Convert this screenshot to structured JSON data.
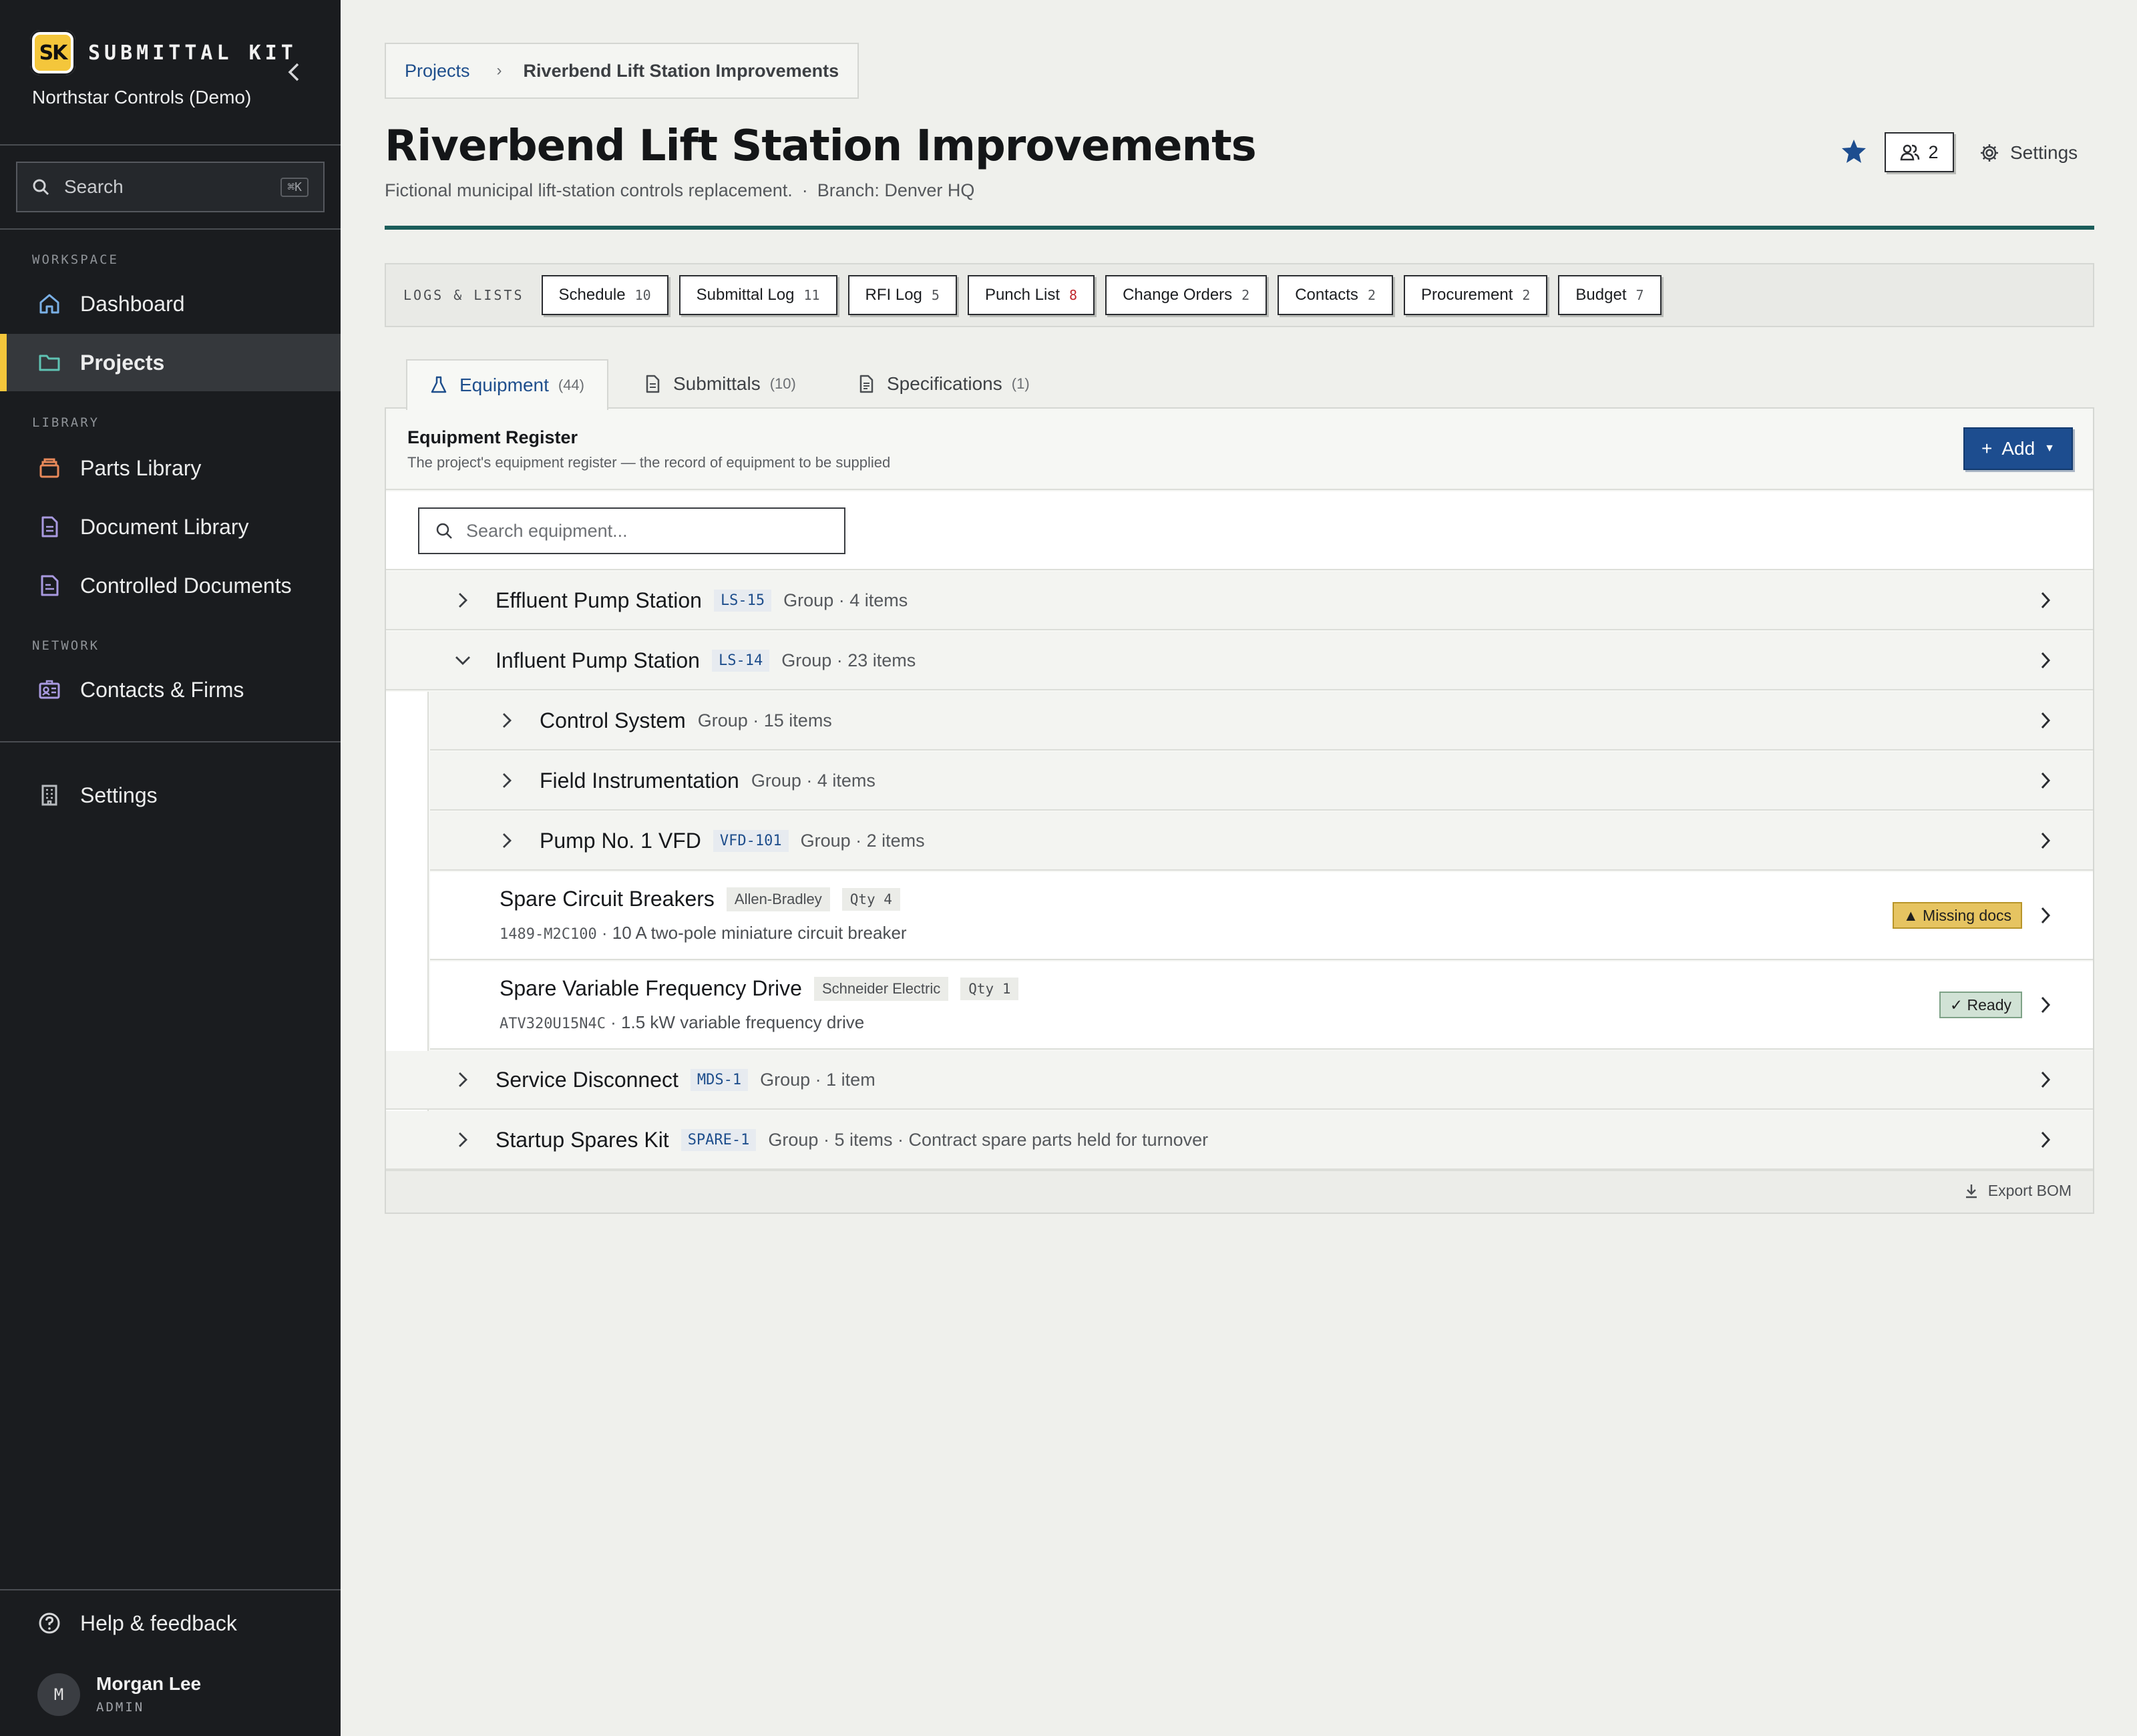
{
  "app": {
    "brand_name": "SUBMITTAL KIT",
    "logo_text": "SK",
    "org_name": "Northstar Controls (Demo)"
  },
  "sidebar": {
    "search_label": "Search",
    "search_shortcut": "⌘K",
    "sections": {
      "workspace": "WORKSPACE",
      "library": "LIBRARY",
      "network": "NETWORK"
    },
    "items": [
      {
        "label": "Dashboard",
        "icon": "home-icon",
        "active": false
      },
      {
        "label": "Projects",
        "icon": "folder-icon",
        "active": true
      },
      {
        "label": "Parts Library",
        "icon": "box-icon",
        "active": false
      },
      {
        "label": "Document Library",
        "icon": "document-icon",
        "active": false
      },
      {
        "label": "Controlled Documents",
        "icon": "controlled-doc-icon",
        "active": false
      },
      {
        "label": "Contacts & Firms",
        "icon": "contact-card-icon",
        "active": false
      },
      {
        "label": "Settings",
        "icon": "building-icon",
        "active": false
      }
    ],
    "help_label": "Help & feedback",
    "user": {
      "initial": "M",
      "name": "Morgan Lee",
      "role": "ADMIN"
    }
  },
  "breadcrumb": {
    "parent": "Projects",
    "current": "Riverbend Lift Station Improvements"
  },
  "project": {
    "title": "Riverbend Lift Station Improvements",
    "description": "Fictional municipal lift-station controls replacement.",
    "branch": "Branch: Denver HQ",
    "members_count": "2",
    "settings_label": "Settings"
  },
  "logs": {
    "label": "LOGS & LISTS",
    "chips": [
      {
        "label": "Schedule",
        "count": "10",
        "alert": false
      },
      {
        "label": "Submittal Log",
        "count": "11",
        "alert": false
      },
      {
        "label": "RFI Log",
        "count": "5",
        "alert": false
      },
      {
        "label": "Punch List",
        "count": "8",
        "alert": true
      },
      {
        "label": "Change Orders",
        "count": "2",
        "alert": false
      },
      {
        "label": "Contacts",
        "count": "2",
        "alert": false
      },
      {
        "label": "Procurement",
        "count": "2",
        "alert": false
      },
      {
        "label": "Budget",
        "count": "7",
        "alert": false
      }
    ]
  },
  "tabs": [
    {
      "label": "Equipment",
      "count": "(44)",
      "icon": "flask-icon",
      "active": true
    },
    {
      "label": "Submittals",
      "count": "(10)",
      "icon": "document-icon",
      "active": false
    },
    {
      "label": "Specifications",
      "count": "(1)",
      "icon": "spec-doc-icon",
      "active": false
    }
  ],
  "register": {
    "title": "Equipment Register",
    "description": "The project's equipment register — the record of equipment to be supplied",
    "add_label": "Add",
    "search_placeholder": "Search equipment...",
    "export_label": "Export BOM",
    "rows": [
      {
        "name": "Effluent Pump Station",
        "code": "LS-15",
        "meta": "Group · 4 items"
      },
      {
        "name": "Influent Pump Station",
        "code": "LS-14",
        "meta": "Group · 23 items"
      },
      {
        "name": "Control System",
        "code": "",
        "meta": "Group · 15 items"
      },
      {
        "name": "Field Instrumentation",
        "code": "",
        "meta": "Group · 4 items"
      },
      {
        "name": "Pump No. 1 VFD",
        "code": "VFD-101",
        "meta": "Group · 2 items"
      },
      {
        "name": "Spare Circuit Breakers",
        "maker": "Allen-Bradley",
        "qty": "Qty 4",
        "part": "1489-M2C100",
        "desc": " · 10 A two-pole miniature circuit breaker",
        "status": "▲ Missing docs"
      },
      {
        "name": "Spare Variable Frequency Drive",
        "maker": "Schneider Electric",
        "qty": "Qty 1",
        "part": "ATV320U15N4C",
        "desc": " · 1.5 kW variable frequency drive",
        "status": "✓ Ready"
      },
      {
        "name": "Service Disconnect",
        "code": "MDS-1",
        "meta": "Group · 1 item"
      },
      {
        "name": "Startup Spares Kit",
        "code": "SPARE-1",
        "meta": "Group · 5 items · Contract spare parts held for turnover"
      }
    ]
  },
  "colors": {
    "accent": "#1d4d8f",
    "brand": "#f4c63b",
    "rule": "#1b5d5a",
    "sidebar": "#1a1c1f"
  }
}
